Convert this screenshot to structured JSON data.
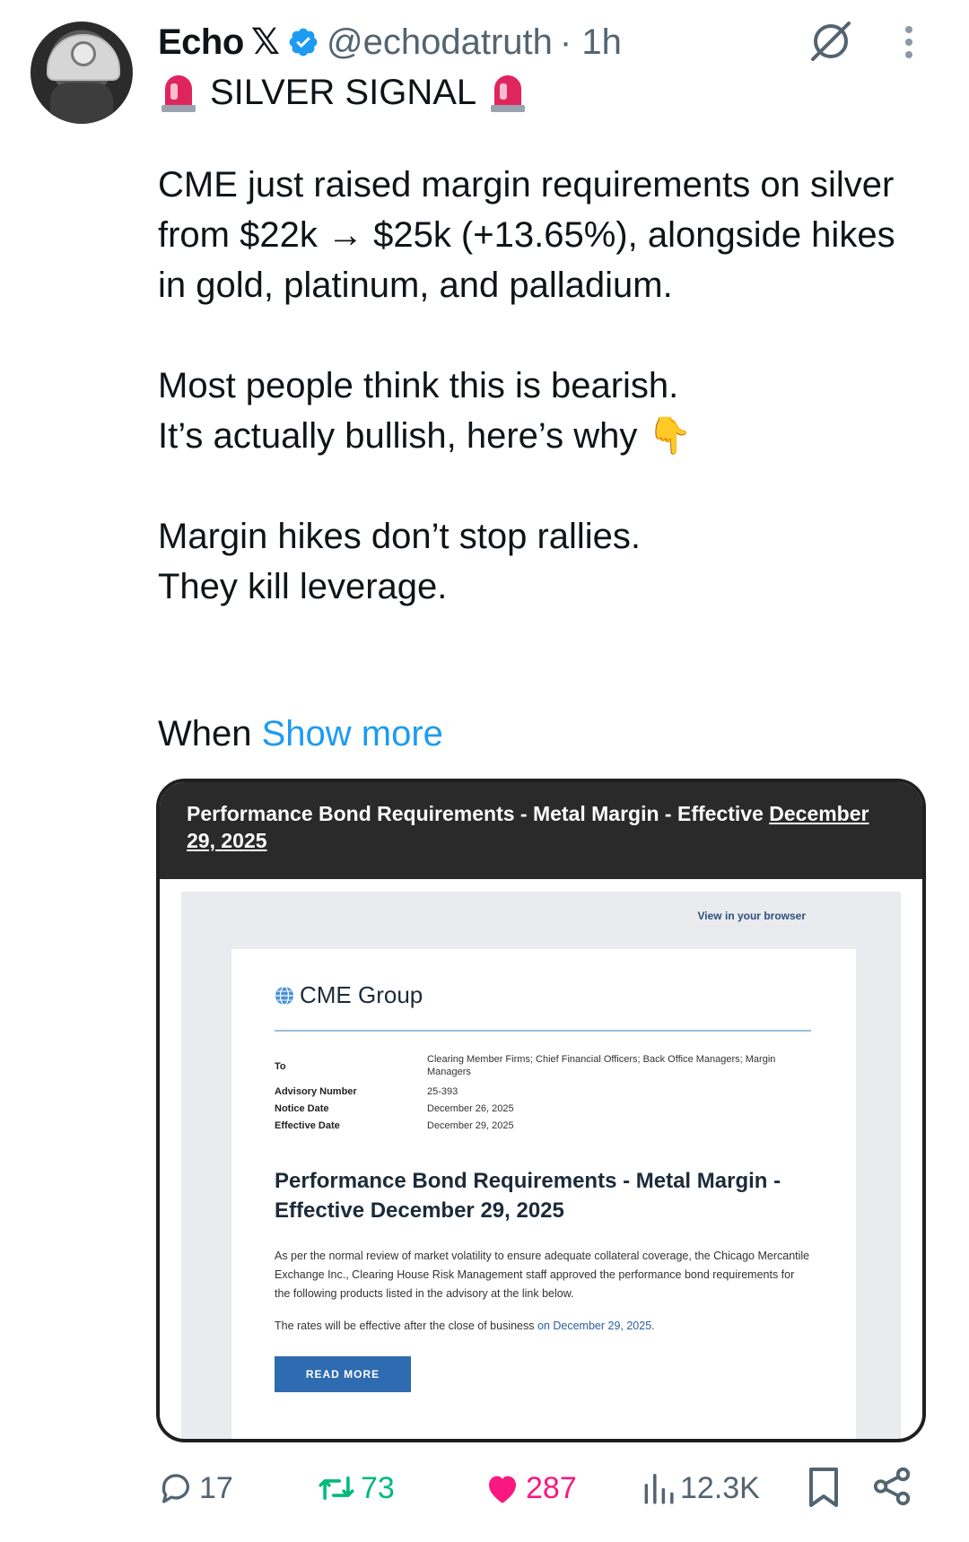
{
  "author": {
    "name": "Echo",
    "handle": "@echodatruth",
    "time": "· 1h"
  },
  "headline": "SILVER SIGNAL",
  "body_text": "CME just raised margin requirements on silver from $22k → $25k (+13.65%), alongside hikes in gold, platinum, and palladium.\n\nMost people think this is bearish.\nIt’s actually bullish, here’s why 👇\n\nMargin hikes don’t stop rallies.\nThey kill leverage.",
  "truncated_word": "When",
  "show_more": "Show more",
  "card": {
    "title_prefix": "Performance Bond Requirements - Metal Margin - Effective",
    "title_date": "December 29, 2025",
    "view_in_browser": "View in your browser",
    "logo_text": "CME Group",
    "meta": [
      {
        "label": "To",
        "value": "Clearing Member Firms; Chief Financial Officers; Back Office Managers; Margin Managers"
      },
      {
        "label": "Advisory Number",
        "value": "25-393"
      },
      {
        "label": "Notice Date",
        "value": "December 26, 2025"
      },
      {
        "label": "Effective Date",
        "value": "December 29, 2025"
      }
    ],
    "email_title": "Performance Bond Requirements - Metal Margin - Effective December 29, 2025",
    "paragraph1": "As per the normal review of market volatility to ensure adequate collateral coverage, the Chicago Mercantile Exchange Inc., Clearing House Risk Management staff approved the performance bond requirements for the following products listed in the advisory at the link below.",
    "paragraph2_prefix": "The rates will be effective after the close of business",
    "paragraph2_link": "on December 29, 2025.",
    "read_more": "READ MORE"
  },
  "actions": {
    "replies": "17",
    "reposts": "73",
    "likes": "287",
    "views": "12.3K"
  },
  "colors": {
    "link": "#1d9bf0",
    "repost": "#00ba7c",
    "like": "#f91880",
    "muted": "#536471",
    "verified": "#1d9bf0"
  }
}
